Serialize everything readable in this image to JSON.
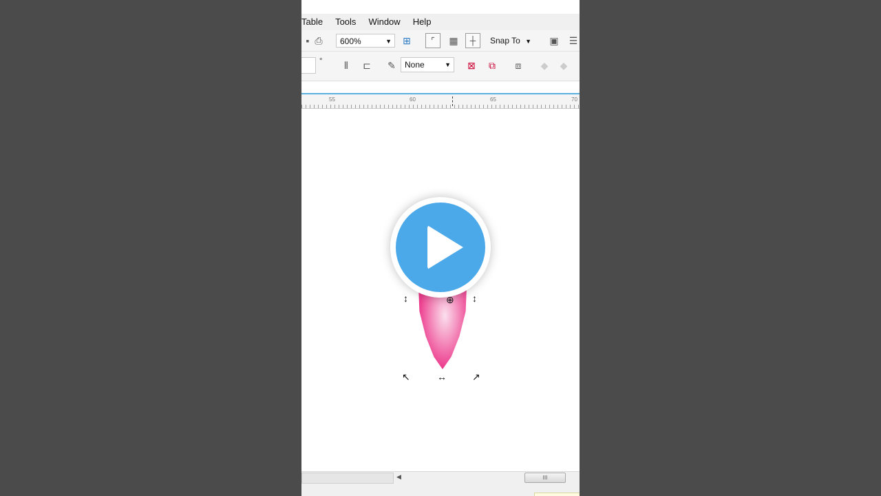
{
  "menu": {
    "items": [
      "Table",
      "Tools",
      "Window",
      "Help"
    ]
  },
  "toolbar": {
    "zoom_value": "600%",
    "snap_label": "Snap To",
    "outline_value": "None",
    "angle_unit": "°"
  },
  "ruler": {
    "labels": [
      "55",
      "60",
      "65",
      "70"
    ]
  },
  "scrollbar": {
    "thumb_grip": "III"
  },
  "colors": {
    "play_button": "#4ba9ea",
    "shape_fill": "#ec3a8c",
    "highlight_line": "#5aaee0"
  },
  "icons": {
    "play": "play-icon"
  }
}
